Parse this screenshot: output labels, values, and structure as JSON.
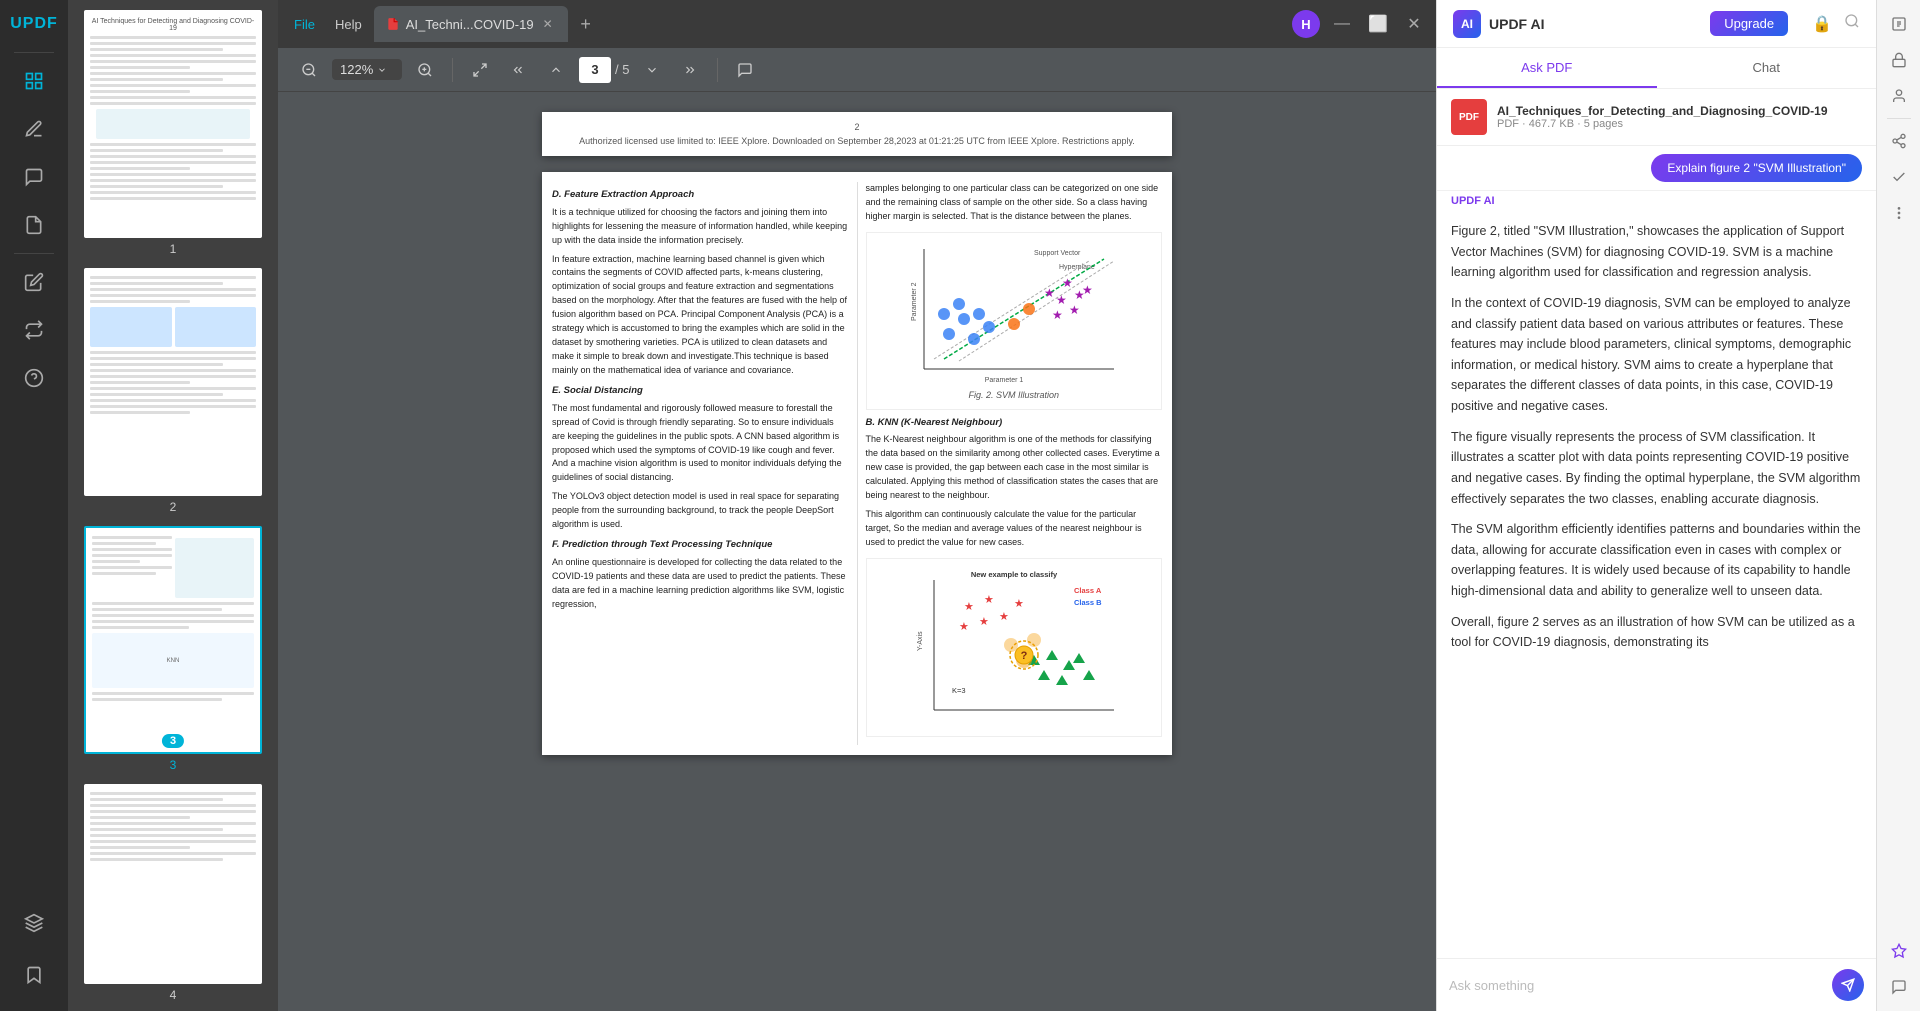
{
  "app": {
    "logo": "UPDF",
    "tab_title": "AI_Techni...COVID-19",
    "menu_file": "File",
    "menu_help": "Help"
  },
  "toolbar": {
    "zoom_level": "122%",
    "page_current": "3",
    "page_total": "5",
    "zoom_out": "−",
    "zoom_in": "+",
    "fit_width": "↔",
    "nav_up": "↑",
    "nav_down": "↓",
    "nav_first": "⇈",
    "nav_last": "⇊",
    "comment": "💬"
  },
  "ai_panel": {
    "title": "UPDF AI",
    "upgrade_label": "Upgrade",
    "tab_ask_pdf": "Ask PDF",
    "tab_chat": "Chat",
    "file_name": "AI_Techniques_for_Detecting_and_Diagnosing_COVID-19",
    "file_meta": "PDF · 467.7 KB · 5 pages",
    "explain_btn": "Explain figure 2 \"SVM Illustration\"",
    "ai_label": "UPDF AI",
    "response_p1": "Figure 2, titled \"SVM Illustration,\" showcases the application of Support Vector Machines (SVM) for diagnosing COVID-19. SVM is a machine learning algorithm used for classification and regression analysis.",
    "response_p2": "In the context of COVID-19 diagnosis, SVM can be employed to analyze and classify patient data based on various attributes or features. These features may include blood parameters, clinical symptoms, demographic information, or medical history. SVM aims to create a hyperplane that separates the different classes of data points, in this case, COVID-19 positive and negative cases.",
    "response_p3": "The figure visually represents the process of SVM classification. It illustrates a scatter plot with data points representing COVID-19 positive and negative cases. By finding the optimal hyperplane, the SVM algorithm effectively separates the two classes, enabling accurate diagnosis.",
    "response_p4": "The SVM algorithm efficiently identifies patterns and boundaries within the data, allowing for accurate classification even in cases with complex or overlapping features. It is widely used because of its capability to handle high-dimensional data and ability to generalize well to unseen data.",
    "response_p5": "Overall, figure 2 serves as an illustration of how SVM can be utilized as a tool for COVID-19 diagnosis, demonstrating its",
    "chat_placeholder": "Ask something"
  },
  "pdf": {
    "page3_header": "Authorized licensed use limited to: IEEE Xplore. Downloaded on September 28,2023 at 01:21:25 UTC from IEEE Xplore.  Restrictions apply.",
    "page_num_header": "2",
    "section_D": "D.   Feature Extraction Approach",
    "section_D_text1": "It is a technique utilized for choosing the factors and joining them into highlights for lessening the measure of information handled, while keeping up with the data inside the information precisely.",
    "section_D_text2": "In feature extraction, machine learning based channel is given which contains the segments of  COVID affected parts, k-means clustering, optimization of social groups and feature extraction and segmentations based on the morphology. After that the features are fused with the help of fusion algorithm based on PCA. Principal Component Analysis (PCA) is a strategy which is accustomed to bring the examples which are solid in the dataset by smothering varieties. PCA is utilized to clean datasets and make it simple to break down and investigate.This technique is based mainly on the mathematical idea of variance and covariance.",
    "section_E": "E.   Social Distancing",
    "section_E_text1": "The most fundamental and rigorously followed measure to forestall the spread of Covid is through friendly separating.  So to ensure individuals are keeping the guidelines in the public spots. A CNN based algorithm is proposed which used the symptoms of COVID-19 like cough and fever. And a machine vision algorithm is used to monitor individuals defying the guidelines of social distancing.",
    "section_E_text2": "The YOLOv3 object detection model is used in real space for separating people from the surrounding background, to track the people DeepSort algorithm is used.",
    "section_F": "F.   Prediction through Text Processing Technique",
    "section_F_text1": "An online questionnaire is developed for collecting the data related to the COVID-19 patients and these data are used to predict the patients. These data are fed in a machine learning prediction algorithms like SVM, logistic regression,",
    "col2_text1": "samples belonging to one particular class can be categorized on one side and the remaining class of sample on the other side. So a class having higher margin is selected. That is the distance between the planes.",
    "col2_text2": "The K-Nearest neighbour algorithm is one of the methods for classifying the data based on the similarity among other collected cases. Everytime a new case is provided, the gap between each case in the most similar is calculated. Applying this method of classification states the cases that are being nearest to the neighbour.",
    "col2_text3": "This algorithm can continuously calculate the value for the particular target,  So the median and average values of the nearest neighbour is used to predict the value for new cases.",
    "section_B": "B.   KNN (K-Nearest Neighbour)",
    "fig2_caption": "Fig. 2.   SVM Illustration",
    "fig3_caption": "New example to classify",
    "class_a_label": "Class A",
    "class_b_label": "Class B",
    "knn_k_label": "K=3",
    "support_vector": "Support Vector",
    "hyperplane": "Hyperplane",
    "param1": "Parameter 1",
    "param2": "Parameter 2",
    "yaxis": "Y-Axis"
  },
  "thumbnails": [
    {
      "number": "1",
      "active": false
    },
    {
      "number": "2",
      "active": false
    },
    {
      "number": "3",
      "active": true
    },
    {
      "number": "4",
      "active": false
    }
  ]
}
